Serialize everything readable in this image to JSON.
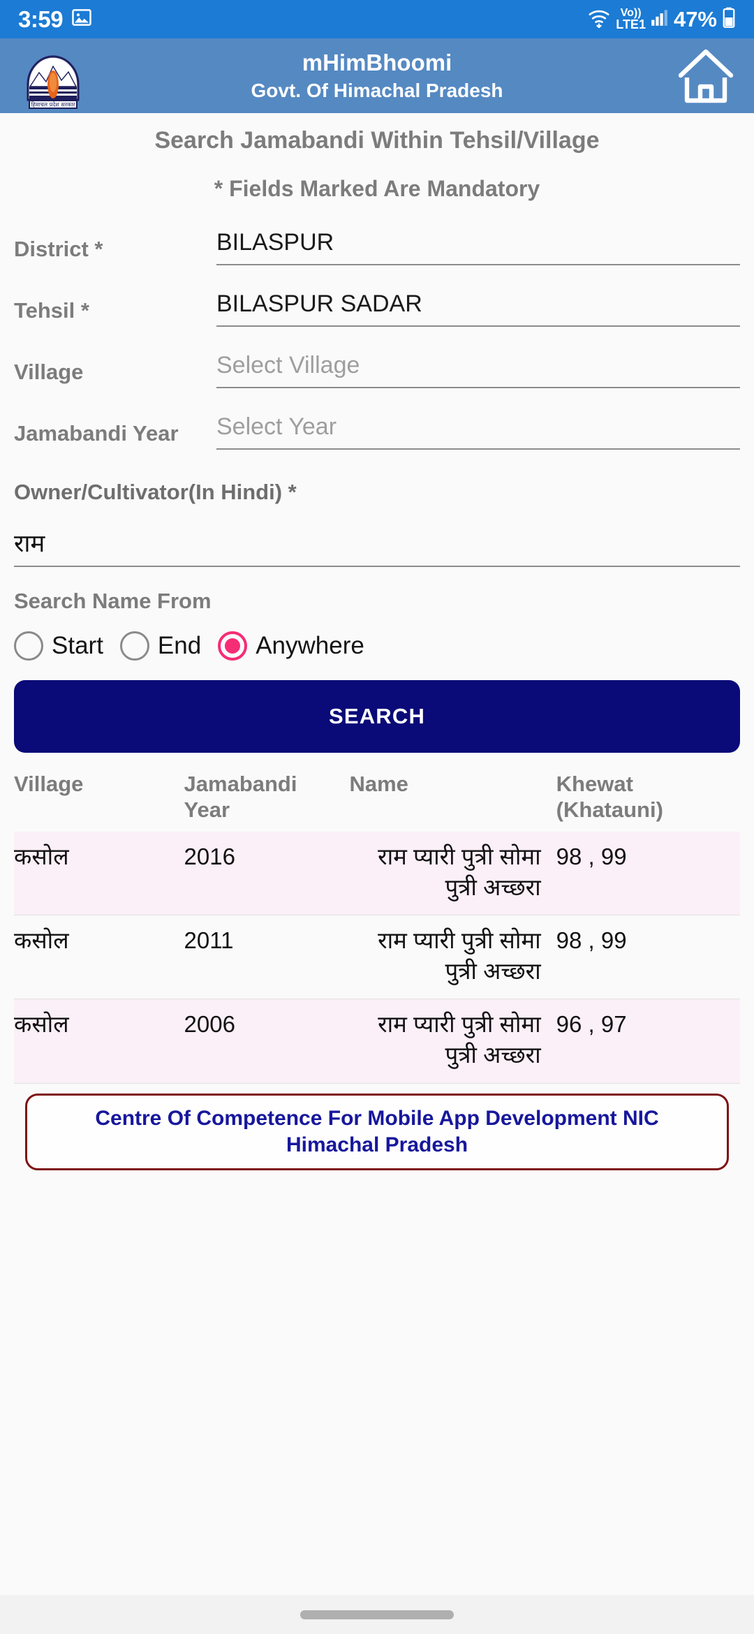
{
  "status_bar": {
    "time": "3:59",
    "gallery_icon": "image-icon",
    "wifi_icon": "wifi-icon",
    "volte_label": "Vo))",
    "network_label": "LTE1",
    "signal_icon": "signal-bars-icon",
    "battery_percent": "47%",
    "battery_icon": "battery-icon"
  },
  "app_bar": {
    "logo": "himachal-pradesh-emblem",
    "title": "mHimBhoomi",
    "subtitle": "Govt. Of Himachal Pradesh",
    "home_icon": "home-icon",
    "background_color": "#5589C2"
  },
  "page": {
    "title": "Search Jamabandi Within Tehsil/Village",
    "mandatory_note": "* Fields Marked Are Mandatory"
  },
  "form": {
    "fields": [
      {
        "label": "District *",
        "value": "BILASPUR",
        "is_placeholder": false
      },
      {
        "label": "Tehsil *",
        "value": "BILASPUR SADAR",
        "is_placeholder": false
      },
      {
        "label": "Village",
        "value": "Select Village",
        "is_placeholder": true
      },
      {
        "label": "Jamabandi Year",
        "value": "Select Year",
        "is_placeholder": true
      }
    ],
    "owner": {
      "label": "Owner/Cultivator(In Hindi) *",
      "value": "राम"
    },
    "search_name_from": {
      "label": "Search Name From",
      "options": [
        {
          "label": "Start",
          "selected": false
        },
        {
          "label": "End",
          "selected": false
        },
        {
          "label": "Anywhere",
          "selected": true
        }
      ],
      "selected_color": "#F62C74"
    },
    "search_button": {
      "label": "SEARCH",
      "color": "#0A0A78"
    }
  },
  "results": {
    "columns": [
      "Village",
      "Jamabandi Year",
      "Name",
      "Khewat (Khatauni)"
    ],
    "rows": [
      {
        "village": "कसोल",
        "year": "2016",
        "name": "राम प्यारी पुत्री  सोमा पुत्री अच्छरा",
        "khewat": "98 , 99"
      },
      {
        "village": "कसोल",
        "year": "2011",
        "name": "राम प्यारी पुत्री  सोमा पुत्री अच्छरा",
        "khewat": "98 , 99"
      },
      {
        "village": "कसोल",
        "year": "2006",
        "name": "राम प्यारी पुत्री  सोमा पुत्री अच्छरा",
        "khewat": "96 , 97"
      }
    ]
  },
  "footer": {
    "line1": "Centre Of Competence For Mobile App Development NIC",
    "line2": "Himachal Pradesh",
    "border_color": "#7E1113",
    "text_color": "#17179C"
  }
}
